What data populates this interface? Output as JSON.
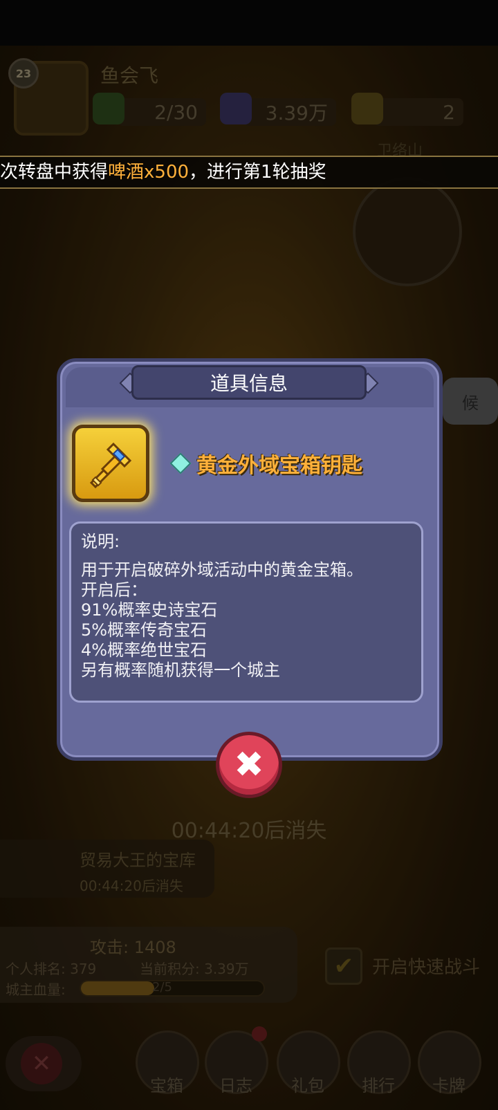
{
  "header": {
    "level": "23",
    "player_name": "鱼会飞",
    "energy": "2/30",
    "points": "3.39万",
    "tickets": "2",
    "sub_label": "卫络山"
  },
  "marquee": {
    "prefix": "次转盘中获得",
    "highlight": "啤酒x500",
    "suffix": "，进行第1轮抽奖"
  },
  "side_button": "候",
  "dialog": {
    "title": "道具信息",
    "item_name": "黄金外域宝箱钥匙",
    "desc_label": "说明:",
    "desc_lines": [
      "用于开启破碎外域活动中的黄金宝箱。",
      "开启后：",
      "91%概率史诗宝石",
      "5%概率传奇宝石",
      "4%概率绝世宝石",
      "另有概率随机获得一个城主"
    ],
    "close_glyph": "✖"
  },
  "background": {
    "timer": "00:44:20后消失",
    "treasure_title": "贸易大王的宝库",
    "treasure_time": "00:44:20后消失",
    "attack": "攻击:  1408",
    "rank": "个人排名:  379",
    "score": "当前积分:  3.39万",
    "hp_label": "城主血量:",
    "hp_text": "2/5",
    "hp_fraction": 0.4,
    "quick_battle": "开启快速战斗"
  },
  "nav": [
    {
      "label": "宝箱"
    },
    {
      "label": "日志"
    },
    {
      "label": "礼包"
    },
    {
      "label": "排行"
    },
    {
      "label": "卡牌"
    }
  ],
  "colors": {
    "highlight": "#ffb13b",
    "dialog": "#676a9c",
    "close_button": "#e0445a"
  }
}
